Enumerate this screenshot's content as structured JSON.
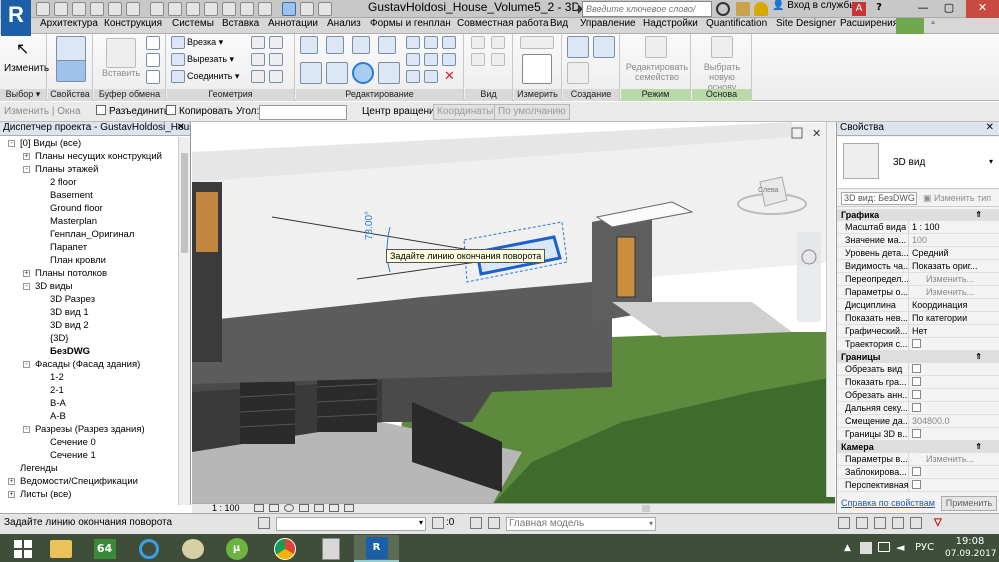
{
  "app": {
    "logo": "R",
    "title": "GustavHoldosi_House_Volume5_2 - 3D в...",
    "search_placeholder": "Введите ключевое слово/фразу",
    "sign_in": "Вход в службы"
  },
  "tabs": [
    "Архитектура",
    "Конструкция",
    "Системы",
    "Вставка",
    "Аннотации",
    "Анализ",
    "Формы и генплан",
    "Совместная работа",
    "Вид",
    "Управление",
    "Надстройки",
    "Quantification",
    "Site Designer",
    "Расширения"
  ],
  "ribbon": {
    "modify_label": "Изменить",
    "cut_label": "Врезка",
    "cut_out_label": "Вырезать",
    "join_label": "Соединить",
    "paste_label": "Вставить",
    "edit_family_label": "Редактировать семейство",
    "select_base_label": "Выбрать новую основу",
    "panels": [
      "Выбор",
      "Свойства",
      "Буфер обмена",
      "Геометрия",
      "Редактирование",
      "Вид",
      "Измерить",
      "Создание",
      "Режим",
      "Основа"
    ]
  },
  "options_bar": {
    "modify_group": "Изменить | Окна",
    "disjoin": "Разъединить",
    "copy": "Копировать",
    "angle_label": "Угол:",
    "rotation_center": "Центр вращения:",
    "coordinates": "Координаты",
    "default": "По умолчанию"
  },
  "project_browser": {
    "title": "Диспетчер проекта - GustavHoldosi_Hous...",
    "items": [
      {
        "label": "[0] Виды (все)",
        "level": 0,
        "exp": "-"
      },
      {
        "label": "Планы несущих конструкций",
        "level": 1,
        "exp": "+"
      },
      {
        "label": "Планы этажей",
        "level": 1,
        "exp": "-"
      },
      {
        "label": "2 floor",
        "level": 2,
        "exp": ""
      },
      {
        "label": "Basement",
        "level": 2,
        "exp": ""
      },
      {
        "label": "Ground floor",
        "level": 2,
        "exp": ""
      },
      {
        "label": "Masterplan",
        "level": 2,
        "exp": ""
      },
      {
        "label": "Генплан_Оригинал",
        "level": 2,
        "exp": ""
      },
      {
        "label": "Парапет",
        "level": 2,
        "exp": ""
      },
      {
        "label": "План кровли",
        "level": 2,
        "exp": ""
      },
      {
        "label": "Планы потолков",
        "level": 1,
        "exp": "+"
      },
      {
        "label": "3D виды",
        "level": 1,
        "exp": "-"
      },
      {
        "label": "3D Разрез",
        "level": 2,
        "exp": ""
      },
      {
        "label": "3D вид 1",
        "level": 2,
        "exp": ""
      },
      {
        "label": "3D вид 2",
        "level": 2,
        "exp": ""
      },
      {
        "label": "{3D}",
        "level": 2,
        "exp": ""
      },
      {
        "label": "БезDWG",
        "level": 2,
        "exp": "",
        "bold": true
      },
      {
        "label": "Фасады (Фасад здания)",
        "level": 1,
        "exp": "-"
      },
      {
        "label": "1-2",
        "level": 2,
        "exp": ""
      },
      {
        "label": "2-1",
        "level": 2,
        "exp": ""
      },
      {
        "label": "B-A",
        "level": 2,
        "exp": ""
      },
      {
        "label": "A-B",
        "level": 2,
        "exp": ""
      },
      {
        "label": "Разрезы (Разрез здания)",
        "level": 1,
        "exp": "-"
      },
      {
        "label": "Сечение 0",
        "level": 2,
        "exp": ""
      },
      {
        "label": "Сечение 1",
        "level": 2,
        "exp": ""
      },
      {
        "label": "Легенды",
        "level": 0,
        "exp": ""
      },
      {
        "label": "Ведомости/Спецификации",
        "level": 0,
        "exp": "+"
      },
      {
        "label": "Листы (все)",
        "level": 0,
        "exp": "+"
      }
    ]
  },
  "viewport": {
    "dimension_text": "78.00°",
    "tooltip": "Задайте линию окончания поворота",
    "viewcube_label": "Слева"
  },
  "properties": {
    "title": "Свойства",
    "type_name": "3D вид",
    "instance_selector": "3D вид: БезDWG",
    "edit_type": "Изменить тип",
    "sections": {
      "graphics": "Графика",
      "extents": "Границы",
      "camera": "Камера"
    },
    "graphics_rows": [
      {
        "key": "Масштаб вида",
        "value": "1 : 100"
      },
      {
        "key": "Значение ма...",
        "value": "100",
        "gray": true
      },
      {
        "key": "Уровень дета...",
        "value": "Средний"
      },
      {
        "key": "Видимость ча...",
        "value": "Показать ориг..."
      },
      {
        "key": "Переопредел...",
        "value": "Изменить...",
        "btn": true
      },
      {
        "key": "Параметры о...",
        "value": "Изменить...",
        "btn": true
      },
      {
        "key": "Дисциплина",
        "value": "Координация"
      },
      {
        "key": "Показать нев...",
        "value": "По категории"
      },
      {
        "key": "Графический...",
        "value": "Нет"
      },
      {
        "key": "Траектория с...",
        "value": "",
        "check": true
      }
    ],
    "extents_rows": [
      {
        "key": "Обрезать вид",
        "value": "",
        "check": true
      },
      {
        "key": "Показать гра...",
        "value": "",
        "check": true
      },
      {
        "key": "Обрезать анн...",
        "value": "",
        "check": true
      },
      {
        "key": "Дальняя секу...",
        "value": "",
        "check": true
      },
      {
        "key": "Смещение да...",
        "value": "304800.0",
        "gray": true
      },
      {
        "key": "Границы 3D в...",
        "value": "",
        "check": true
      }
    ],
    "camera_rows": [
      {
        "key": "Параметры в...",
        "value": "Изменить...",
        "btn": true
      },
      {
        "key": "Заблокирова...",
        "value": "",
        "check": true
      },
      {
        "key": "Перспективная",
        "value": "",
        "check": true
      }
    ],
    "help_link": "Справка по свойствам",
    "apply": "Применить"
  },
  "view_control": {
    "scale": "1 : 100"
  },
  "status": {
    "message": "Задайте линию окончания поворота",
    "zero": ":0",
    "model": "Главная модель"
  },
  "taskbar": {
    "lang": "РУС",
    "time": "19:08",
    "date": "07.09.2017",
    "app_64": "64"
  },
  "colors": {
    "title_bar": "#c8c8c8",
    "ribbon_accent": "#1b5fa8",
    "taskbar": "#3f4e39",
    "selection_blue": "#2a7bd4"
  }
}
